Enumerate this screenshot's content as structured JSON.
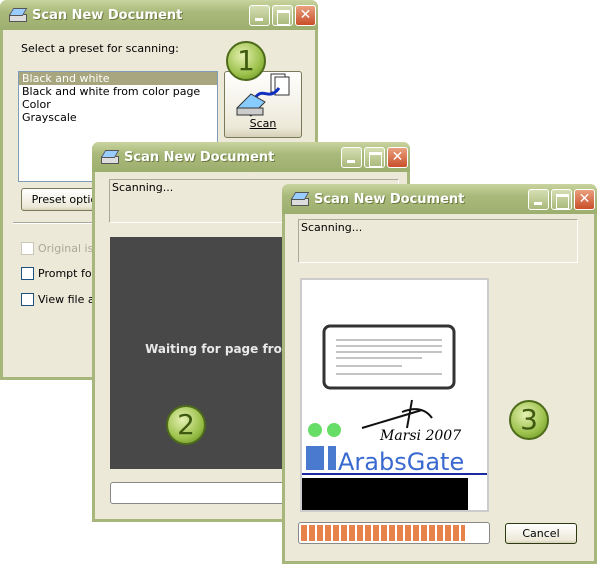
{
  "windows": [
    {
      "title": "Scan New Document",
      "prompt": "Select a preset for scanning:",
      "presets": [
        "Black and white",
        "Black and white from color page",
        "Color",
        "Grayscale"
      ],
      "selected_preset": "Black and white",
      "scan_button": "Scan",
      "preset_options_button": "Preset options...",
      "checkboxes": [
        {
          "label": "Original is double-sided",
          "enabled": false,
          "checked": false
        },
        {
          "label": "Prompt for additional pages",
          "enabled": true,
          "checked": false
        },
        {
          "label": "View file after scanning",
          "enabled": true,
          "checked": false
        }
      ],
      "badge": "1"
    },
    {
      "title": "Scan New Document",
      "status": "Scanning...",
      "message": "Waiting for page from scanner.",
      "badge": "2",
      "progress_percent": 0
    },
    {
      "title": "Scan New Document",
      "status": "Scanning...",
      "badge": "3",
      "progress_percent": 88,
      "cancel_button": "Cancel",
      "preview": {
        "signature_text": "Marsi 2007",
        "logo_text": "ArabsGate"
      }
    }
  ],
  "colors": {
    "titlebar": "#A9B97B",
    "selection": "#A7A67E",
    "progress": "#E7824A",
    "waiting_panel": "#484848",
    "badge": "#9BC04A"
  }
}
